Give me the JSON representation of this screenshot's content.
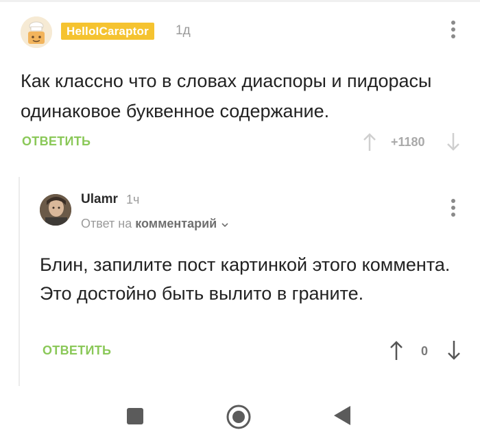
{
  "comment": {
    "username": "HelloICaraptor",
    "time": "1д",
    "text": "Как классно что в словах диаспоры и пидорасы одинаковое буквенное содержание.",
    "reply_label": "ОТВЕТИТЬ",
    "score": "+1180"
  },
  "reply": {
    "username": "Ulamr",
    "time": "1ч",
    "reply_to_prefix": "Ответ на",
    "reply_to_target": "комментарий",
    "text": "Блин, запилите пост картинкой этого коммента. Это достойно быть вылито в граните.",
    "reply_label": "ОТВЕТИТЬ",
    "score": "0"
  },
  "colors": {
    "badge": "#f5c330",
    "reply_action": "#8ac858",
    "muted": "#9a9a9a"
  },
  "icons": {
    "more": "more-vertical-icon",
    "upvote": "arrow-up-icon",
    "downvote": "arrow-down-icon",
    "chevron": "chevron-down-icon",
    "nav_recents": "square-icon",
    "nav_home": "circle-icon",
    "nav_back": "triangle-back-icon"
  }
}
